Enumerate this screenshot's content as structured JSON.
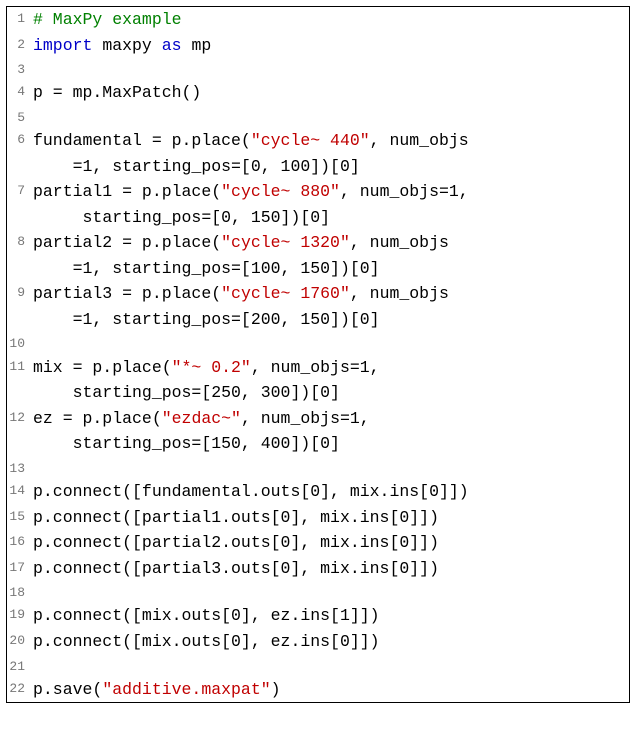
{
  "lines": [
    {
      "n": "1",
      "segs": [
        {
          "cls": "comment",
          "t": "# MaxPy example"
        }
      ]
    },
    {
      "n": "2",
      "segs": [
        {
          "cls": "keyword",
          "t": "import"
        },
        {
          "t": " maxpy "
        },
        {
          "cls": "keyword",
          "t": "as"
        },
        {
          "t": " mp"
        }
      ]
    },
    {
      "n": "3",
      "segs": [
        {
          "t": ""
        }
      ]
    },
    {
      "n": "4",
      "segs": [
        {
          "t": "p = mp.MaxPatch()"
        }
      ]
    },
    {
      "n": "5",
      "segs": [
        {
          "t": ""
        }
      ]
    },
    {
      "n": "6",
      "segs": [
        {
          "t": "fundamental = p.place("
        },
        {
          "cls": "string",
          "t": "\"cycle~ 440\""
        },
        {
          "t": ", num_objs"
        }
      ],
      "cont": [
        {
          "t": "=1, starting_pos=[0, 100])[0]"
        }
      ]
    },
    {
      "n": "7",
      "segs": [
        {
          "t": "partial1 = p.place("
        },
        {
          "cls": "string",
          "t": "\"cycle~ 880\""
        },
        {
          "t": ", num_objs=1,"
        }
      ],
      "cont": [
        {
          "t": " starting_pos=[0, 150])[0]"
        }
      ]
    },
    {
      "n": "8",
      "segs": [
        {
          "t": "partial2 = p.place("
        },
        {
          "cls": "string",
          "t": "\"cycle~ 1320\""
        },
        {
          "t": ", num_objs"
        }
      ],
      "cont": [
        {
          "t": "=1, starting_pos=[100, 150])[0]"
        }
      ]
    },
    {
      "n": "9",
      "segs": [
        {
          "t": "partial3 = p.place("
        },
        {
          "cls": "string",
          "t": "\"cycle~ 1760\""
        },
        {
          "t": ", num_objs"
        }
      ],
      "cont": [
        {
          "t": "=1, starting_pos=[200, 150])[0]"
        }
      ]
    },
    {
      "n": "10",
      "segs": [
        {
          "t": ""
        }
      ]
    },
    {
      "n": "11",
      "segs": [
        {
          "t": "mix = p.place("
        },
        {
          "cls": "string",
          "t": "\"*~ 0.2\""
        },
        {
          "t": ", num_objs=1,"
        }
      ],
      "cont": [
        {
          "t": "starting_pos=[250, 300])[0]"
        }
      ]
    },
    {
      "n": "12",
      "segs": [
        {
          "t": "ez = p.place("
        },
        {
          "cls": "string",
          "t": "\"ezdac~\""
        },
        {
          "t": ", num_objs=1,"
        }
      ],
      "cont": [
        {
          "t": "starting_pos=[150, 400])[0]"
        }
      ]
    },
    {
      "n": "13",
      "segs": [
        {
          "t": ""
        }
      ]
    },
    {
      "n": "14",
      "segs": [
        {
          "t": "p.connect([fundamental.outs[0], mix.ins[0]])"
        }
      ]
    },
    {
      "n": "15",
      "segs": [
        {
          "t": "p.connect([partial1.outs[0], mix.ins[0]])"
        }
      ]
    },
    {
      "n": "16",
      "segs": [
        {
          "t": "p.connect([partial2.outs[0], mix.ins[0]])"
        }
      ]
    },
    {
      "n": "17",
      "segs": [
        {
          "t": "p.connect([partial3.outs[0], mix.ins[0]])"
        }
      ]
    },
    {
      "n": "18",
      "segs": [
        {
          "t": ""
        }
      ]
    },
    {
      "n": "19",
      "segs": [
        {
          "t": "p.connect([mix.outs[0], ez.ins[1]])"
        }
      ]
    },
    {
      "n": "20",
      "segs": [
        {
          "t": "p.connect([mix.outs[0], ez.ins[0]])"
        }
      ]
    },
    {
      "n": "21",
      "segs": [
        {
          "t": ""
        }
      ]
    },
    {
      "n": "22",
      "segs": [
        {
          "t": "p.save("
        },
        {
          "cls": "string",
          "t": "\"additive.maxpat\""
        },
        {
          "t": ")"
        }
      ]
    }
  ]
}
